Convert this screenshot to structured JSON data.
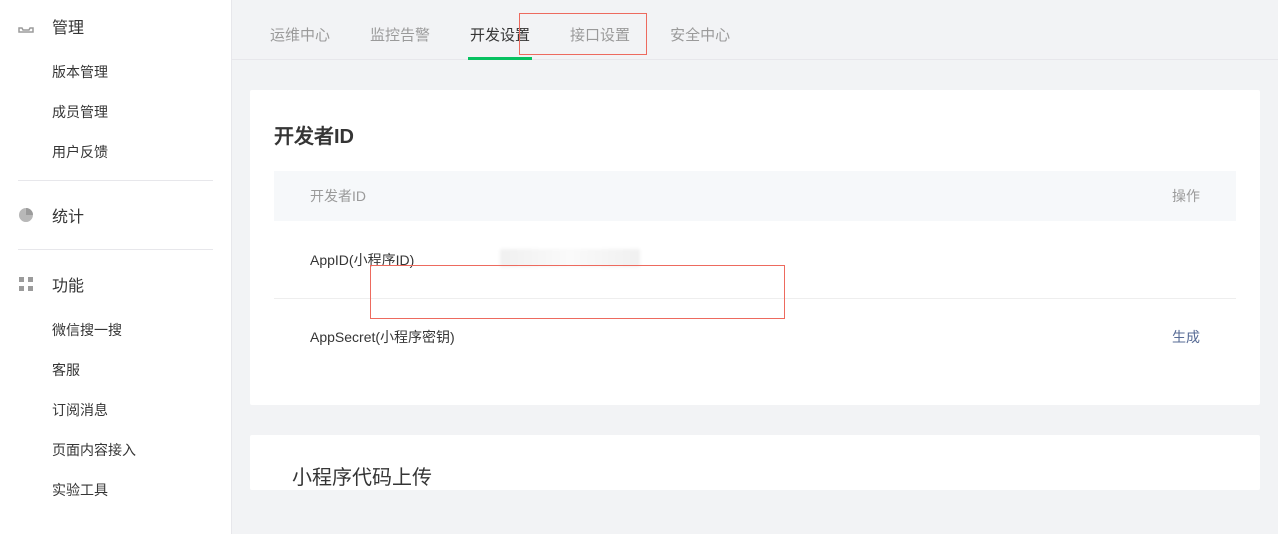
{
  "sidebar": {
    "sections": [
      {
        "label": "管理",
        "icon": "inbox-icon",
        "items": [
          "版本管理",
          "成员管理",
          "用户反馈"
        ]
      },
      {
        "label": "统计",
        "icon": "piechart-icon",
        "items": []
      },
      {
        "label": "功能",
        "icon": "grid-icon",
        "items": [
          "微信搜一搜",
          "客服",
          "订阅消息",
          "页面内容接入",
          "实验工具"
        ]
      }
    ]
  },
  "tabs": {
    "items": [
      "运维中心",
      "监控告警",
      "开发设置",
      "接口设置",
      "安全中心"
    ],
    "active_index": 2
  },
  "dev_id_card": {
    "title": "开发者ID",
    "header_label": "开发者ID",
    "header_action": "操作",
    "rows": [
      {
        "label": "AppID(小程序ID)",
        "value": "",
        "action": ""
      },
      {
        "label": "AppSecret(小程序密钥)",
        "value": "",
        "action": "生成"
      }
    ]
  },
  "second_card_partial_title": "小程序代码上传"
}
